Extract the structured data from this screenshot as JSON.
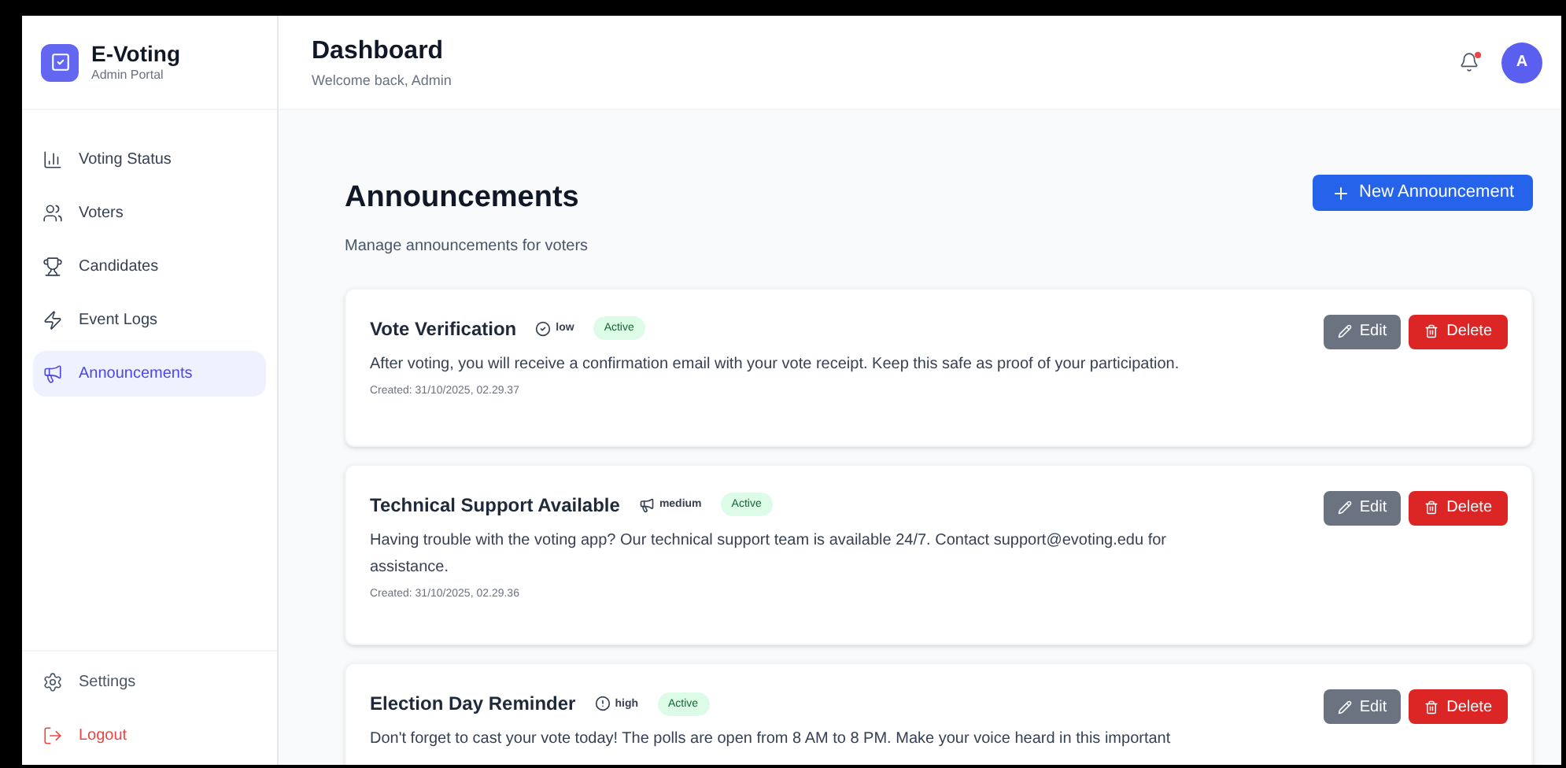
{
  "brand": {
    "name": "E-Voting",
    "subtitle": "Admin Portal"
  },
  "nav": [
    {
      "label": "Voting Status",
      "kind": "chart",
      "selected": false
    },
    {
      "label": "Voters",
      "kind": "users",
      "selected": false
    },
    {
      "label": "Candidates",
      "kind": "trophy",
      "selected": false
    },
    {
      "label": "Event Logs",
      "kind": "zap",
      "selected": false
    },
    {
      "label": "Announcements",
      "kind": "megaphone",
      "selected": true
    }
  ],
  "footer_nav": [
    {
      "label": "Settings",
      "kind": "settings"
    },
    {
      "label": "Logout",
      "kind": "logout"
    }
  ],
  "header": {
    "title": "Dashboard",
    "subtitle": "Welcome back, Admin",
    "notification_unread": true,
    "avatar": "A"
  },
  "page": {
    "title": "Announcements",
    "subtitle": "Manage announcements for voters",
    "new_button": "New Announcement"
  },
  "announcements": [
    {
      "title": "Vote Verification",
      "priority": "low",
      "kind": "low",
      "status": "Active",
      "body": "After voting, you will receive a confirmation email with your vote receipt. Keep this safe as proof of your participation.",
      "created": "Created: 31/10/2025, 02.29.37",
      "edit": "Edit",
      "delete": "Delete"
    },
    {
      "title": "Technical Support Available",
      "priority": "medium",
      "kind": "medium",
      "status": "Active",
      "body": "Having trouble with the voting app? Our technical support team is available 24/7. Contact support@evoting.edu for assistance.",
      "created": "Created: 31/10/2025, 02.29.36",
      "edit": "Edit",
      "delete": "Delete"
    },
    {
      "title": "Election Day Reminder",
      "priority": "high",
      "kind": "high",
      "status": "Active",
      "body": "Don't forget to cast your vote today! The polls are open from 8 AM to 8 PM. Make your voice heard in this important",
      "edit": "Edit",
      "delete": "Delete"
    }
  ]
}
